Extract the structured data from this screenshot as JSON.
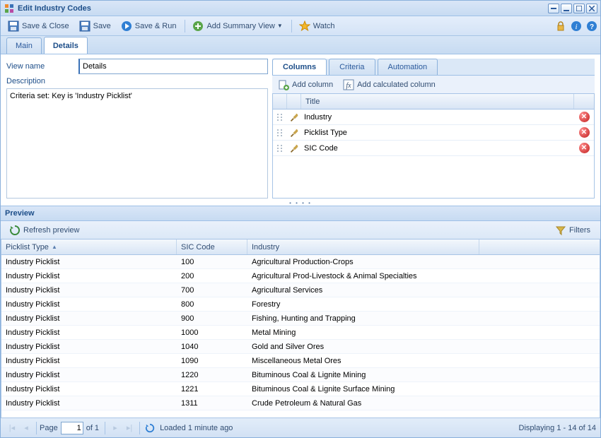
{
  "window": {
    "title": "Edit Industry Codes"
  },
  "toolbar": {
    "save_close": "Save & Close",
    "save": "Save",
    "save_run": "Save & Run",
    "add_summary": "Add Summary View",
    "watch": "Watch"
  },
  "top_tabs": {
    "main": "Main",
    "details": "Details"
  },
  "form": {
    "view_name_label": "View name",
    "view_name_value": "Details",
    "description_label": "Description",
    "description_value": "Criteria set: Key is 'Industry Picklist'"
  },
  "columns_panel": {
    "tabs": {
      "columns": "Columns",
      "criteria": "Criteria",
      "automation": "Automation"
    },
    "add_column": "Add column",
    "add_calc_column": "Add calculated column",
    "header_title": "Title",
    "rows": [
      {
        "title": "Industry"
      },
      {
        "title": "Picklist Type"
      },
      {
        "title": "SIC Code"
      }
    ]
  },
  "preview": {
    "header": "Preview",
    "refresh": "Refresh preview",
    "filters": "Filters",
    "columns": {
      "picklist": "Picklist Type",
      "sic": "SIC Code",
      "industry": "Industry"
    },
    "rows": [
      {
        "picklist": "Industry Picklist",
        "sic": "100",
        "industry": "Agricultural Production-Crops"
      },
      {
        "picklist": "Industry Picklist",
        "sic": "200",
        "industry": "Agricultural Prod-Livestock & Animal Specialties"
      },
      {
        "picklist": "Industry Picklist",
        "sic": "700",
        "industry": "Agricultural Services"
      },
      {
        "picklist": "Industry Picklist",
        "sic": "800",
        "industry": "Forestry"
      },
      {
        "picklist": "Industry Picklist",
        "sic": "900",
        "industry": "Fishing, Hunting and Trapping"
      },
      {
        "picklist": "Industry Picklist",
        "sic": "1000",
        "industry": "Metal Mining"
      },
      {
        "picklist": "Industry Picklist",
        "sic": "1040",
        "industry": "Gold and Silver Ores"
      },
      {
        "picklist": "Industry Picklist",
        "sic": "1090",
        "industry": "Miscellaneous Metal Ores"
      },
      {
        "picklist": "Industry Picklist",
        "sic": "1220",
        "industry": "Bituminous Coal & Lignite Mining"
      },
      {
        "picklist": "Industry Picklist",
        "sic": "1221",
        "industry": "Bituminous Coal & Lignite Surface Mining"
      },
      {
        "picklist": "Industry Picklist",
        "sic": "1311",
        "industry": "Crude Petroleum & Natural Gas"
      }
    ]
  },
  "paging": {
    "page_label": "Page",
    "page_value": "1",
    "of_label": "of 1",
    "loaded": "Loaded 1 minute ago",
    "display": "Displaying 1 - 14 of 14"
  }
}
